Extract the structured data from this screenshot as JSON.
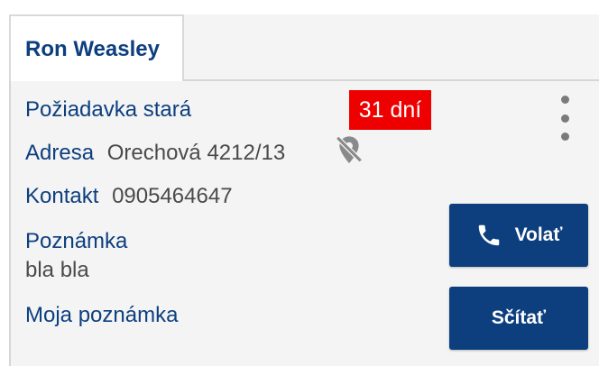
{
  "tab": {
    "label": "Ron Weasley"
  },
  "request": {
    "label": "Požiadavka stará",
    "age_badge": "31 dní"
  },
  "address": {
    "label": "Adresa",
    "value": "Orechová 4212/13"
  },
  "contact": {
    "label": "Kontakt",
    "value": "0905464647"
  },
  "note": {
    "label": "Poznámka",
    "value": "bla bla"
  },
  "my_note": {
    "label": "Moja poznámka"
  },
  "actions": {
    "call_label": "Volať",
    "count_label": "Sčítať"
  },
  "colors": {
    "brand": "#0d3f7f",
    "badge": "#ee0000",
    "card_bg": "#f4f4f4"
  },
  "icons": {
    "menu": "more-vertical-icon",
    "location_off": "location-off-icon",
    "phone": "phone-icon"
  }
}
